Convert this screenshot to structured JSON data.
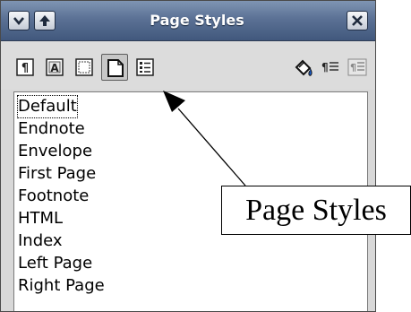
{
  "window": {
    "title": "Page Styles",
    "titlebar_buttons": [
      "chevron-down-icon",
      "arrow-up-icon",
      "close-icon"
    ]
  },
  "toolbar": {
    "buttons": [
      {
        "name": "paragraph-styles",
        "icon": "pilcrow-icon"
      },
      {
        "name": "character-styles",
        "icon": "character-a-icon"
      },
      {
        "name": "frame-styles",
        "icon": "frame-icon"
      },
      {
        "name": "page-styles",
        "icon": "page-icon",
        "active": true
      },
      {
        "name": "list-styles",
        "icon": "list-icon"
      },
      {
        "name": "fill-format-mode",
        "icon": "paint-bucket-icon"
      },
      {
        "name": "new-style-from-selection",
        "icon": "new-style-icon"
      },
      {
        "name": "update-style",
        "icon": "update-style-icon"
      }
    ]
  },
  "styles_list": {
    "items": [
      "Default",
      "Endnote",
      "Envelope",
      "First Page",
      "Footnote",
      "HTML",
      "Index",
      "Left Page",
      "Right Page"
    ],
    "selected": "Default"
  },
  "callout": {
    "label": "Page Styles"
  },
  "colors": {
    "titlebar": "#5b7195",
    "window_bg": "#d8d8d8",
    "list_bg": "#ffffff"
  }
}
